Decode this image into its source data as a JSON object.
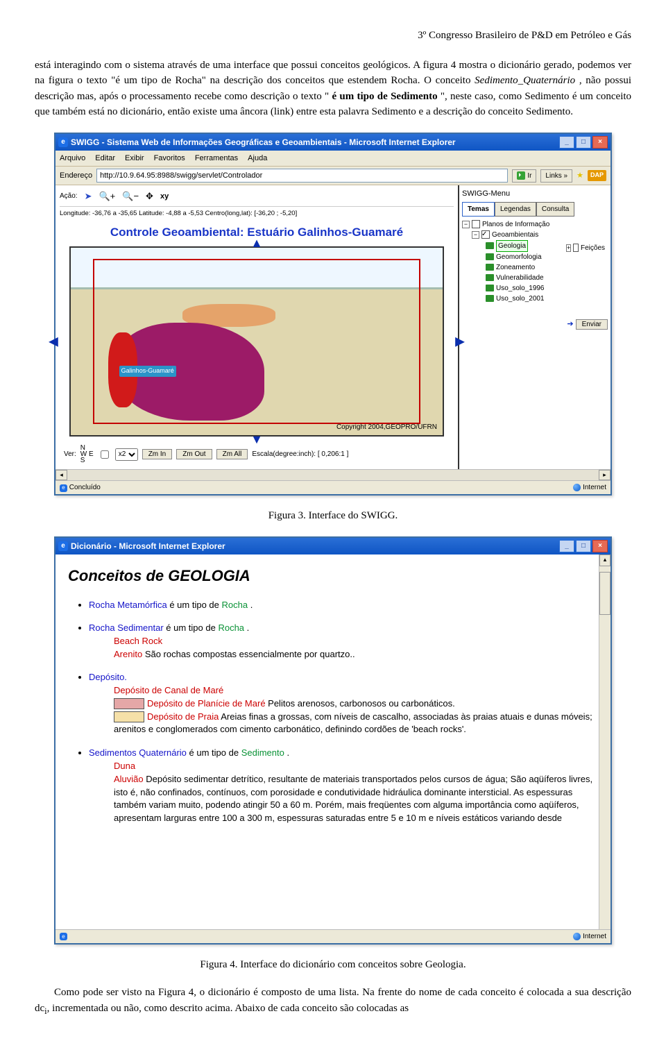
{
  "header": {
    "text": "3º Congresso Brasileiro de P&D em Petróleo e Gás"
  },
  "para1": {
    "seg1": "está interagindo com o sistema através de uma interface que possui conceitos geológicos. A figura 4 mostra o dicionário gerado, podemos ver na figura o texto \"é um tipo de Rocha\" na descrição dos conceitos que estendem Rocha. O conceito ",
    "ital1": "Sedimento_Quaternário",
    "seg2": ", não possui descrição mas, após o processamento recebe como descrição o texto \"",
    "bold1": "é um tipo de Sedimento",
    "seg3": "\", neste caso, como Sedimento é um conceito que também está no dicionário, então existe uma âncora (link) entre esta palavra Sedimento e a descrição do conceito Sedimento."
  },
  "fig3": {
    "caption": "Figura 3. Interface do SWIGG.",
    "windowTitle": "SWIGG - Sistema Web de Informações Geográficas e Geoambientais - Microsoft Internet Explorer",
    "menu": [
      "Arquivo",
      "Editar",
      "Exibir",
      "Favoritos",
      "Ferramentas",
      "Ajuda"
    ],
    "addrLabel": "Endereço",
    "url": "http://10.9.64.95:8988/swigg/servlet/Controlador",
    "goLabel": "Ir",
    "linksLabel": "Links »",
    "dap": "DAP",
    "toolbar": {
      "acao": "Ação:"
    },
    "coords": "Longitude: -36,76 a -35,65      Latitude: -4,88 a -5,53      Centro(long,lat): [-36,20 ; -5,20]",
    "title": "Controle Geoambiental: Estuário Galinhos-Guamaré",
    "mapLabel": "Galinhos-Guamaré",
    "copyright": "Copyright 2004,GEOPRO/UFRN",
    "verLabel": "Ver:",
    "zoomSel": "x2",
    "btnZmIn": "Zm In",
    "btnZmOut": "Zm Out",
    "btnZmAll": "Zm All",
    "scale": "Escala(degree:inch): [ 0,206:1 ]",
    "sideHeader": "SWIGG-Menu",
    "tabs": [
      "Temas",
      "Legendas",
      "Consulta"
    ],
    "tree": {
      "root": "Planos de Informação",
      "group": "Geoambientais",
      "items": [
        "Geologia",
        "Geomorfologia",
        "Zoneamento",
        "Vulnerabilidade",
        "Uso_solo_1996",
        "Uso_solo_2001"
      ],
      "feicoes": "Feições"
    },
    "enviar": "Enviar",
    "statusLeft": "Concluído",
    "statusRight": "Internet"
  },
  "fig4": {
    "caption": "Figura 4. Interface do dicionário com conceitos sobre Geologia.",
    "windowTitle": "Dicionário - Microsoft Internet Explorer",
    "heading": "Conceitos de GEOLOGIA",
    "item1": {
      "name": "Rocha Metamórfica",
      "rest": " é um tipo de ",
      "link": "Rocha",
      "tail": "      ."
    },
    "item2": {
      "name": "Rocha Sedimentar",
      "rest": " é um tipo de ",
      "link": "Rocha",
      "tail": "      .",
      "sub1": "Beach Rock",
      "sub2a": "Arenito",
      "sub2b": " São rochas compostas essencialmente por quartzo.."
    },
    "item3": {
      "name": "Depósito.",
      "s1a": "Depósito de Canal de Maré",
      "s2a": "Depósito de Planície de Maré",
      "s2b": " Pelitos arenosos, carbonosos ou carbonáticos.",
      "s3a": "Depósito de Praia",
      "s3b": " Areias finas a grossas, com níveis de cascalho, associadas às praias atuais e dunas móveis; arenitos e conglomerados com cimento carbonático, definindo cordões de 'beach rocks'."
    },
    "item4": {
      "name": "Sedimentos Quaternário",
      "rest": " é um tipo de ",
      "link": "Sedimento",
      "tail": "      .",
      "s1": "Duna",
      "s2a": "Aluvião",
      "s2b": " Depósito sedimentar detrítico, resultante de materiais transportados pelos cursos de água; São aqüíferos livres, isto é, não confinados, contínuos, com porosidade e condutividade hidráulica dominante intersticial. As espessuras também variam muito, podendo atingir 50 a 60 m. Porém, mais freqüentes com alguma importância como aqüíferos, apresentam larguras entre 100 a 300 m, espessuras saturadas entre 5 e 10 m e níveis estáticos variando desde"
    },
    "statusRight": "Internet"
  },
  "trailing": {
    "seg1": "Como pode ser visto na Figura 4, o dicionário é composto de uma lista. Na frente do nome de cada conceito é colocada a sua descrição dc",
    "sub": "i",
    "seg2": ", incrementada ou não, como descrito acima. Abaixo de cada conceito são colocadas as"
  }
}
